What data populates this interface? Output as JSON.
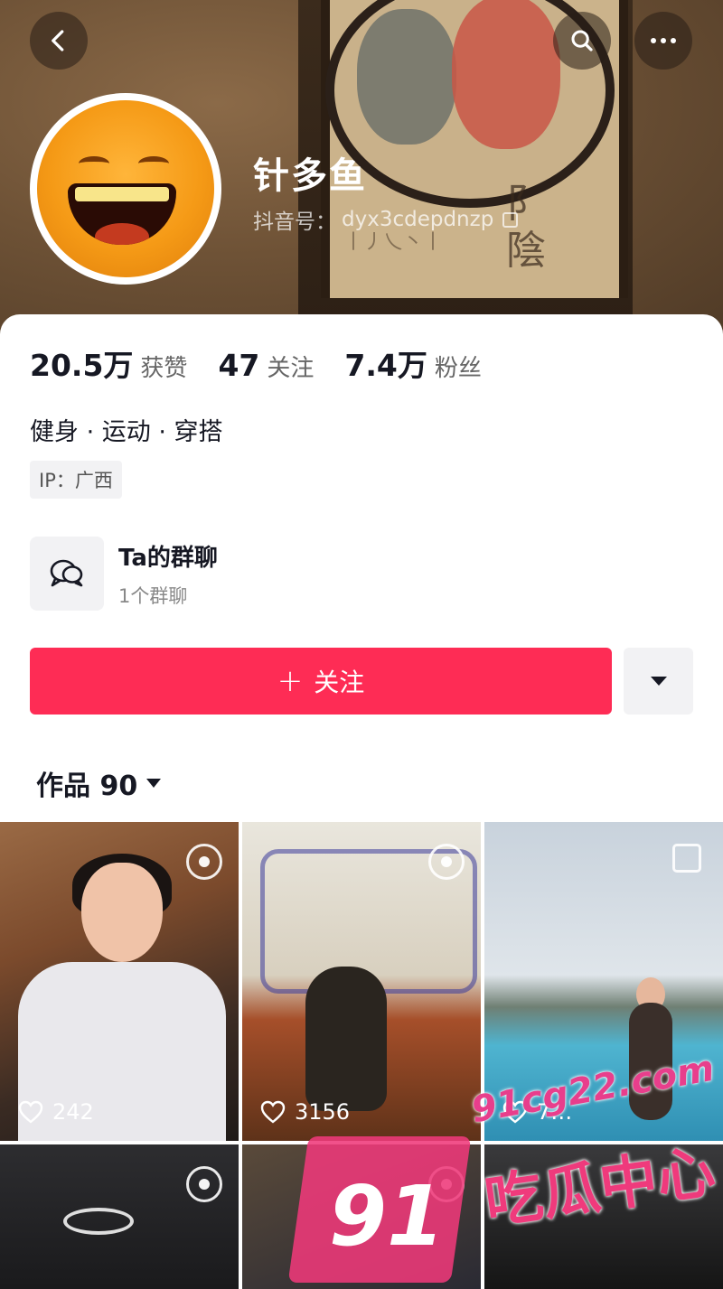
{
  "header": {
    "back_icon": "chevron-left-icon",
    "search_icon": "search-icon",
    "more_icon": "more-dots-icon"
  },
  "profile": {
    "name": "针多鱼",
    "douyin_id_label": "抖音号：",
    "douyin_id": "dyx3cdepdnzp",
    "stats": [
      {
        "value": "20.5万",
        "label": "获赞"
      },
      {
        "value": "47",
        "label": "关注"
      },
      {
        "value": "7.4万",
        "label": "粉丝"
      }
    ],
    "bio": "健身 · 运动 · 穿搭",
    "ip": "IP：广西"
  },
  "group_chat": {
    "title": "Ta的群聊",
    "subtitle": "1个群聊",
    "icon": "chat-bubbles-icon"
  },
  "actions": {
    "follow_label": "关注",
    "follow_color": "#fe2c55"
  },
  "works": {
    "tab_label": "作品 90",
    "items": [
      {
        "likes": "242",
        "badge": "live-photo-icon"
      },
      {
        "likes": "3156",
        "badge": "live-photo-icon"
      },
      {
        "likes": "7…",
        "badge": "multi-image-icon"
      },
      {
        "badge": "live-photo-icon"
      },
      {
        "badge": "live-photo-icon"
      },
      {}
    ]
  },
  "watermark": {
    "url": "91cg22.com",
    "number": "91",
    "text": "吃瓜中心",
    "color": "#ef3a7c"
  }
}
